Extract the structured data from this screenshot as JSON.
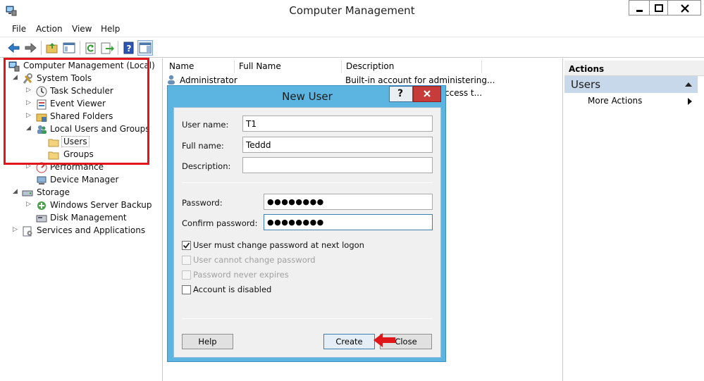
{
  "window": {
    "title": "Computer Management"
  },
  "menu": [
    "File",
    "Action",
    "View",
    "Help"
  ],
  "tree": {
    "root": "Computer Management (Local)",
    "system_tools": "System Tools",
    "task_scheduler": "Task Scheduler",
    "event_viewer": "Event Viewer",
    "shared_folders": "Shared Folders",
    "local_users_groups": "Local Users and Groups",
    "users": "Users",
    "groups": "Groups",
    "performance": "Performance",
    "device_manager": "Device Manager",
    "storage": "Storage",
    "windows_server_backup": "Windows Server Backup",
    "disk_management": "Disk Management",
    "services_apps": "Services and Applications"
  },
  "list": {
    "columns": [
      "Name",
      "Full Name",
      "Description"
    ],
    "rows": [
      {
        "name": "Administrator",
        "full_name": "",
        "description": "Built-in account for administering..."
      },
      {
        "name": "",
        "full_name": "",
        "description": "ccess t..."
      }
    ]
  },
  "actions": {
    "header": "Actions",
    "group": "Users",
    "more": "More Actions"
  },
  "dialog": {
    "title": "New User",
    "help_glyph": "?",
    "close_glyph": "x",
    "username_label": "User name:",
    "username_value": "T1",
    "fullname_label": "Full name:",
    "fullname_value": "Teddd",
    "description_label": "Description:",
    "description_value": "",
    "password_label": "Password:",
    "password_value": "●●●●●●●●",
    "confirm_label": "Confirm password:",
    "confirm_value": "●●●●●●●●",
    "must_change": {
      "label": "User must change password at next logon",
      "checked": true,
      "enabled": true
    },
    "cannot_change": {
      "label": "User cannot change password",
      "checked": false,
      "enabled": false
    },
    "never_expires": {
      "label": "Password never expires",
      "checked": false,
      "enabled": false
    },
    "disabled": {
      "label": "Account is disabled",
      "checked": false,
      "enabled": true
    },
    "help_button": "Help",
    "create_button": "Create",
    "close_button": "Close"
  },
  "colors": {
    "highlight": "#e0161a",
    "dialog_frame": "#5cb4e0",
    "actions_group": "#c8d8eb"
  }
}
